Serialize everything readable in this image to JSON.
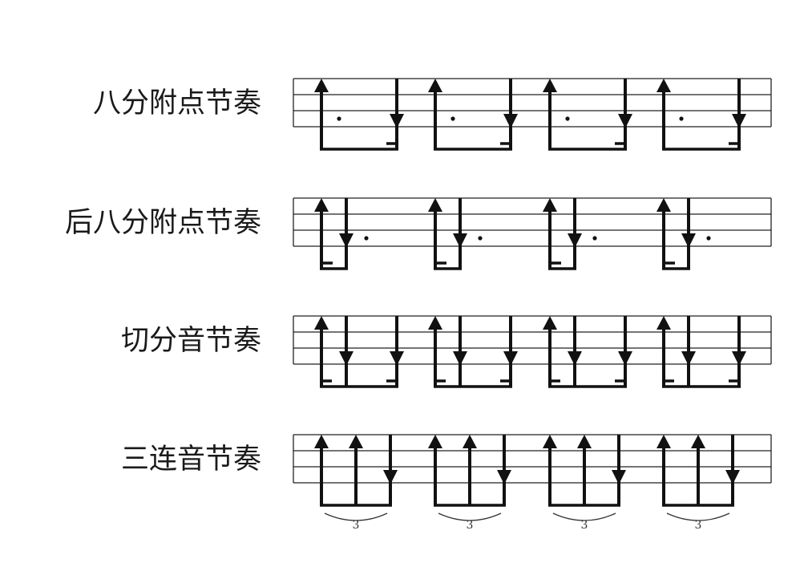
{
  "rows": [
    {
      "label": "八分附点节奏",
      "pattern": "dotted-eighth"
    },
    {
      "label": "后八分附点节奏",
      "pattern": "reverse-dotted"
    },
    {
      "label": "切分音节奏",
      "pattern": "syncopation"
    },
    {
      "label": "三连音节奏",
      "pattern": "triplet",
      "tuplet_number": "3"
    }
  ],
  "stroke_legend": {
    "up": "arrow-up-icon",
    "down": "arrow-down-icon"
  },
  "groups_per_row": 4,
  "colors": {
    "ink": "#111111",
    "label": "#1a1a1a"
  }
}
